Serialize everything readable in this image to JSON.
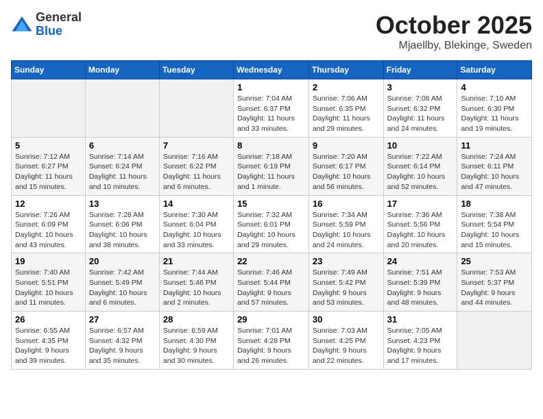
{
  "logo": {
    "general": "General",
    "blue": "Blue"
  },
  "title": "October 2025",
  "location": "Mjaellby, Blekinge, Sweden",
  "days_of_week": [
    "Sunday",
    "Monday",
    "Tuesday",
    "Wednesday",
    "Thursday",
    "Friday",
    "Saturday"
  ],
  "weeks": [
    [
      {
        "day": "",
        "info": ""
      },
      {
        "day": "",
        "info": ""
      },
      {
        "day": "",
        "info": ""
      },
      {
        "day": "1",
        "info": "Sunrise: 7:04 AM\nSunset: 6:37 PM\nDaylight: 11 hours\nand 33 minutes."
      },
      {
        "day": "2",
        "info": "Sunrise: 7:06 AM\nSunset: 6:35 PM\nDaylight: 11 hours\nand 29 minutes."
      },
      {
        "day": "3",
        "info": "Sunrise: 7:08 AM\nSunset: 6:32 PM\nDaylight: 11 hours\nand 24 minutes."
      },
      {
        "day": "4",
        "info": "Sunrise: 7:10 AM\nSunset: 6:30 PM\nDaylight: 11 hours\nand 19 minutes."
      }
    ],
    [
      {
        "day": "5",
        "info": "Sunrise: 7:12 AM\nSunset: 6:27 PM\nDaylight: 11 hours\nand 15 minutes."
      },
      {
        "day": "6",
        "info": "Sunrise: 7:14 AM\nSunset: 6:24 PM\nDaylight: 11 hours\nand 10 minutes."
      },
      {
        "day": "7",
        "info": "Sunrise: 7:16 AM\nSunset: 6:22 PM\nDaylight: 11 hours\nand 6 minutes."
      },
      {
        "day": "8",
        "info": "Sunrise: 7:18 AM\nSunset: 6:19 PM\nDaylight: 11 hours\nand 1 minute."
      },
      {
        "day": "9",
        "info": "Sunrise: 7:20 AM\nSunset: 6:17 PM\nDaylight: 10 hours\nand 56 minutes."
      },
      {
        "day": "10",
        "info": "Sunrise: 7:22 AM\nSunset: 6:14 PM\nDaylight: 10 hours\nand 52 minutes."
      },
      {
        "day": "11",
        "info": "Sunrise: 7:24 AM\nSunset: 6:11 PM\nDaylight: 10 hours\nand 47 minutes."
      }
    ],
    [
      {
        "day": "12",
        "info": "Sunrise: 7:26 AM\nSunset: 6:09 PM\nDaylight: 10 hours\nand 43 minutes."
      },
      {
        "day": "13",
        "info": "Sunrise: 7:28 AM\nSunset: 6:06 PM\nDaylight: 10 hours\nand 38 minutes."
      },
      {
        "day": "14",
        "info": "Sunrise: 7:30 AM\nSunset: 6:04 PM\nDaylight: 10 hours\nand 33 minutes."
      },
      {
        "day": "15",
        "info": "Sunrise: 7:32 AM\nSunset: 6:01 PM\nDaylight: 10 hours\nand 29 minutes."
      },
      {
        "day": "16",
        "info": "Sunrise: 7:34 AM\nSunset: 5:59 PM\nDaylight: 10 hours\nand 24 minutes."
      },
      {
        "day": "17",
        "info": "Sunrise: 7:36 AM\nSunset: 5:56 PM\nDaylight: 10 hours\nand 20 minutes."
      },
      {
        "day": "18",
        "info": "Sunrise: 7:38 AM\nSunset: 5:54 PM\nDaylight: 10 hours\nand 15 minutes."
      }
    ],
    [
      {
        "day": "19",
        "info": "Sunrise: 7:40 AM\nSunset: 5:51 PM\nDaylight: 10 hours\nand 11 minutes."
      },
      {
        "day": "20",
        "info": "Sunrise: 7:42 AM\nSunset: 5:49 PM\nDaylight: 10 hours\nand 6 minutes."
      },
      {
        "day": "21",
        "info": "Sunrise: 7:44 AM\nSunset: 5:46 PM\nDaylight: 10 hours\nand 2 minutes."
      },
      {
        "day": "22",
        "info": "Sunrise: 7:46 AM\nSunset: 5:44 PM\nDaylight: 9 hours\nand 57 minutes."
      },
      {
        "day": "23",
        "info": "Sunrise: 7:49 AM\nSunset: 5:42 PM\nDaylight: 9 hours\nand 53 minutes."
      },
      {
        "day": "24",
        "info": "Sunrise: 7:51 AM\nSunset: 5:39 PM\nDaylight: 9 hours\nand 48 minutes."
      },
      {
        "day": "25",
        "info": "Sunrise: 7:53 AM\nSunset: 5:37 PM\nDaylight: 9 hours\nand 44 minutes."
      }
    ],
    [
      {
        "day": "26",
        "info": "Sunrise: 6:55 AM\nSunset: 4:35 PM\nDaylight: 9 hours\nand 39 minutes."
      },
      {
        "day": "27",
        "info": "Sunrise: 6:57 AM\nSunset: 4:32 PM\nDaylight: 9 hours\nand 35 minutes."
      },
      {
        "day": "28",
        "info": "Sunrise: 6:59 AM\nSunset: 4:30 PM\nDaylight: 9 hours\nand 30 minutes."
      },
      {
        "day": "29",
        "info": "Sunrise: 7:01 AM\nSunset: 4:28 PM\nDaylight: 9 hours\nand 26 minutes."
      },
      {
        "day": "30",
        "info": "Sunrise: 7:03 AM\nSunset: 4:25 PM\nDaylight: 9 hours\nand 22 minutes."
      },
      {
        "day": "31",
        "info": "Sunrise: 7:05 AM\nSunset: 4:23 PM\nDaylight: 9 hours\nand 17 minutes."
      },
      {
        "day": "",
        "info": ""
      }
    ]
  ]
}
